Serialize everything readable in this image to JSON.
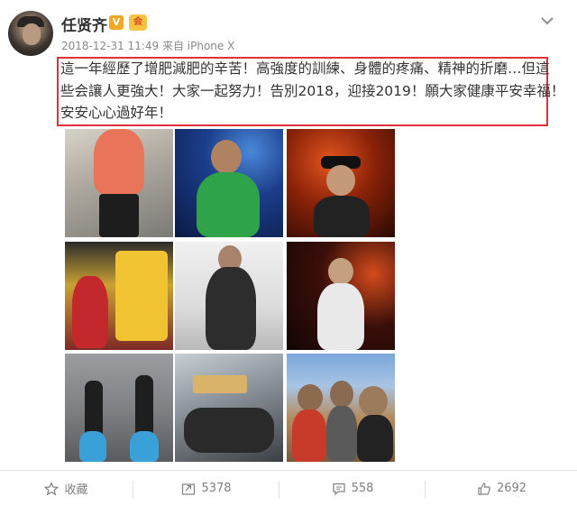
{
  "author": {
    "name": "任贤齐",
    "verified_badge": "V",
    "member_badge": "会"
  },
  "post": {
    "meta": "2018-12-31 11:49 来自 iPhone X",
    "text_lines": [
      "這一年經歷了增肥減肥的辛苦！高強度的訓練、身體的疼痛、精神的折磨…但這",
      "些会讓人更強大！大家一起努力！告別2018，迎接2019！願大家健康平安幸福！",
      "安安心心過好年！"
    ],
    "photo_count": 9
  },
  "actions": {
    "favorite_label": "收藏",
    "repost_count": "5378",
    "comment_count": "558",
    "like_count": "2692"
  },
  "colors": {
    "highlight_border": "#e0313b",
    "verified": "#f5a623",
    "meta_text": "#888888"
  }
}
